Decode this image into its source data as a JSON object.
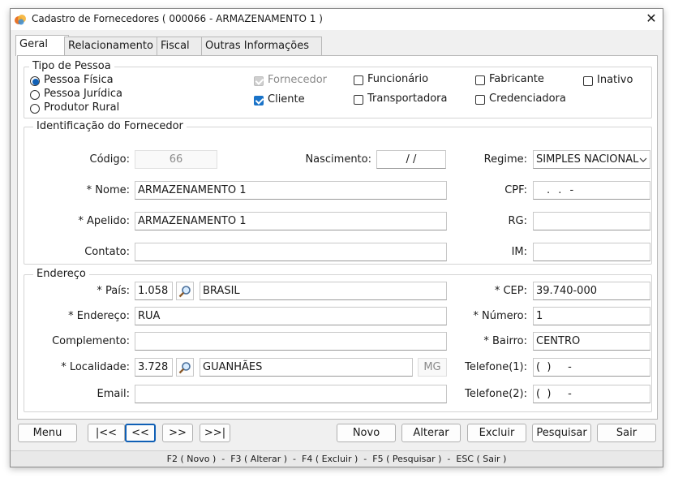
{
  "window": {
    "title": "Cadastro de Fornecedores ( 000066 - ARMAZENAMENTO 1 )",
    "app_icon": "app-logo-icon",
    "close_glyph": "✕"
  },
  "tabs": [
    "Geral",
    "Relacionamento",
    "Fiscal",
    "Outras Informações"
  ],
  "tipo_pessoa": {
    "legend": "Tipo de Pessoa",
    "radios": [
      {
        "label": "Pessoa Física",
        "checked": true
      },
      {
        "label": "Pessoa Jurídica",
        "checked": false
      },
      {
        "label": "Produtor Rural",
        "checked": false
      }
    ],
    "checks": [
      {
        "label": "Fornecedor",
        "checked": true,
        "disabled": true
      },
      {
        "label": "Cliente",
        "checked": true,
        "disabled": false
      },
      {
        "label": "Funcionário",
        "checked": false,
        "disabled": false
      },
      {
        "label": "Transportadora",
        "checked": false,
        "disabled": false
      },
      {
        "label": "Fabricante",
        "checked": false,
        "disabled": false
      },
      {
        "label": "Credenciadora",
        "checked": false,
        "disabled": false
      },
      {
        "label": "Inativo",
        "checked": false,
        "disabled": false
      }
    ]
  },
  "identificacao": {
    "legend": "Identificação do Fornecedor",
    "codigo_label": "Código:",
    "codigo_value": "66",
    "nascimento_label": "Nascimento:",
    "nascimento_value": "/ /",
    "regime_label": "Regime:",
    "regime_value": "SIMPLES NACIONAL",
    "nome_label": "* Nome:",
    "nome_value": "ARMAZENAMENTO 1",
    "cpf_label": "CPF:",
    "cpf_value": ". . -",
    "apelido_label": "* Apelido:",
    "apelido_value": "ARMAZENAMENTO 1",
    "rg_label": "RG:",
    "rg_value": "",
    "contato_label": "Contato:",
    "contato_value": "",
    "im_label": "IM:",
    "im_value": ""
  },
  "endereco": {
    "legend": "Endereço",
    "pais_label": "* País:",
    "pais_code": "1.058",
    "pais_name": "BRASIL",
    "cep_label": "* CEP:",
    "cep_value": "39.740-000",
    "endereco_label": "* Endereço:",
    "endereco_value": "RUA",
    "numero_label": "* Número:",
    "numero_value": "1",
    "complemento_label": "Complemento:",
    "complemento_value": "",
    "bairro_label": "* Bairro:",
    "bairro_value": "CENTRO",
    "localidade_label": "* Localidade:",
    "localidade_code": "3.728",
    "localidade_name": "GUANHÃES",
    "uf_value": "MG",
    "telefone1_label": "Telefone(1):",
    "telefone1_value": "(  )     -",
    "email_label": "Email:",
    "email_value": "",
    "telefone2_label": "Telefone(2):",
    "telefone2_value": "(  )     -"
  },
  "nav_buttons": [
    "Menu",
    "|<<",
    "<<",
    ">>",
    ">>|"
  ],
  "action_buttons": [
    "Novo",
    "Alterar",
    "Excluir",
    "Pesquisar",
    "Sair"
  ],
  "status_bar": "F2 ( Novo )  -  F3 ( Alterar )  -  F4 ( Excluir )  -  F5 ( Pesquisar )  -  ESC ( Sair )",
  "colors": {
    "accent": "#1a73c8",
    "window_bg": "#f0f0f0"
  }
}
